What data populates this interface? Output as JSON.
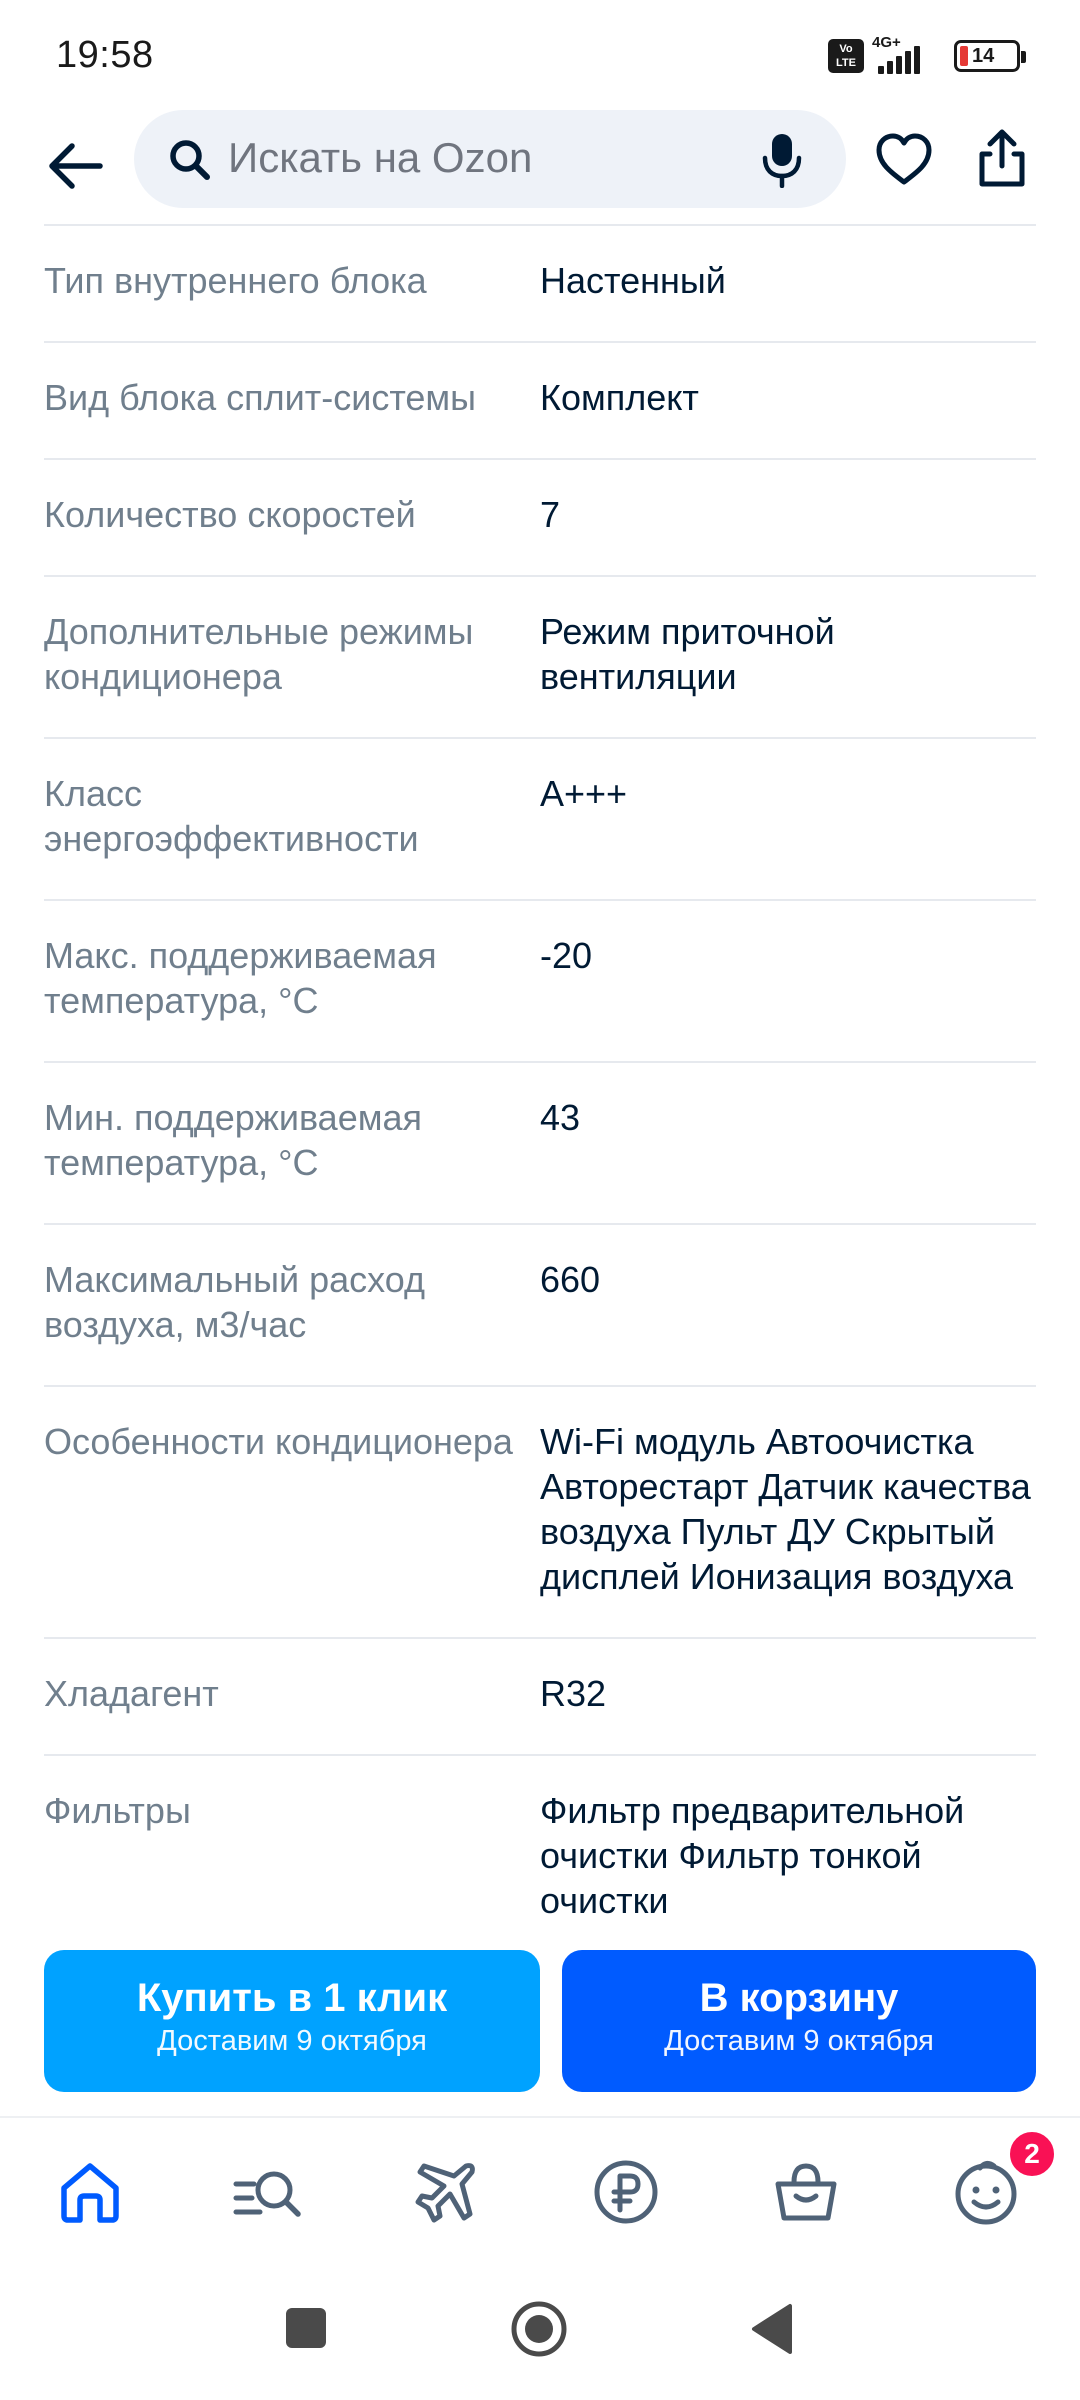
{
  "status_bar": {
    "time": "19:58",
    "volte": "Vo\nLTE",
    "network": "4G+",
    "battery_level": "14",
    "battery_color": "#e53935"
  },
  "header": {
    "back_icon": "arrow-left-icon",
    "search_placeholder": "Искать на Ozon",
    "mic_icon": "microphone-icon",
    "favorite_icon": "heart-icon",
    "share_icon": "share-icon"
  },
  "specs": [
    {
      "label": "Тип внутреннего блока",
      "value": "Настенный"
    },
    {
      "label": "Вид блока сплит-системы",
      "value": "Комплект"
    },
    {
      "label": "Количество скоростей",
      "value": "7"
    },
    {
      "label": "Дополнительные режимы кондиционера",
      "value": "Режим приточной вентиляции"
    },
    {
      "label": "Класс энергоэффективности",
      "value": "A+++"
    },
    {
      "label": "Макс. поддерживаемая температура, °C",
      "value": "-20"
    },
    {
      "label": "Мин. поддерживаемая температура, °C",
      "value": "43"
    },
    {
      "label": "Максимальный расход воздуха, м3/час",
      "value": "660"
    },
    {
      "label": "Особенности кондиционера",
      "value": "Wi-Fi модуль Автоочистка Авторестарт Датчик качества воздуха Пульт ДУ Скрытый дисплей Ионизация воздуха"
    },
    {
      "label": "Хладагент",
      "value": "R32"
    },
    {
      "label": "Фильтры",
      "value": "Фильтр предварительной очистки Фильтр тонкой очистки"
    }
  ],
  "actions": {
    "one_click": {
      "title": "Купить в 1 клик",
      "subtitle": "Доставим 9 октября",
      "color": "#00a2ff"
    },
    "cart": {
      "title": "В корзину",
      "subtitle": "Доставим 9 октября",
      "color": "#005bff"
    }
  },
  "tabbar": {
    "items": [
      {
        "name": "home",
        "icon": "home-icon",
        "active": true
      },
      {
        "name": "catalog",
        "icon": "catalog-search-icon"
      },
      {
        "name": "travel",
        "icon": "airplane-icon"
      },
      {
        "name": "finance",
        "icon": "ruble-icon"
      },
      {
        "name": "cart",
        "icon": "basket-icon"
      },
      {
        "name": "profile",
        "icon": "smiley-face-icon"
      }
    ],
    "profile_badge": "2",
    "active_color": "#005bff",
    "inactive_color": "#4f6277"
  },
  "system_nav": {
    "recents_icon": "square-icon",
    "home_icon": "circle-icon",
    "back_icon": "triangle-back-icon"
  }
}
